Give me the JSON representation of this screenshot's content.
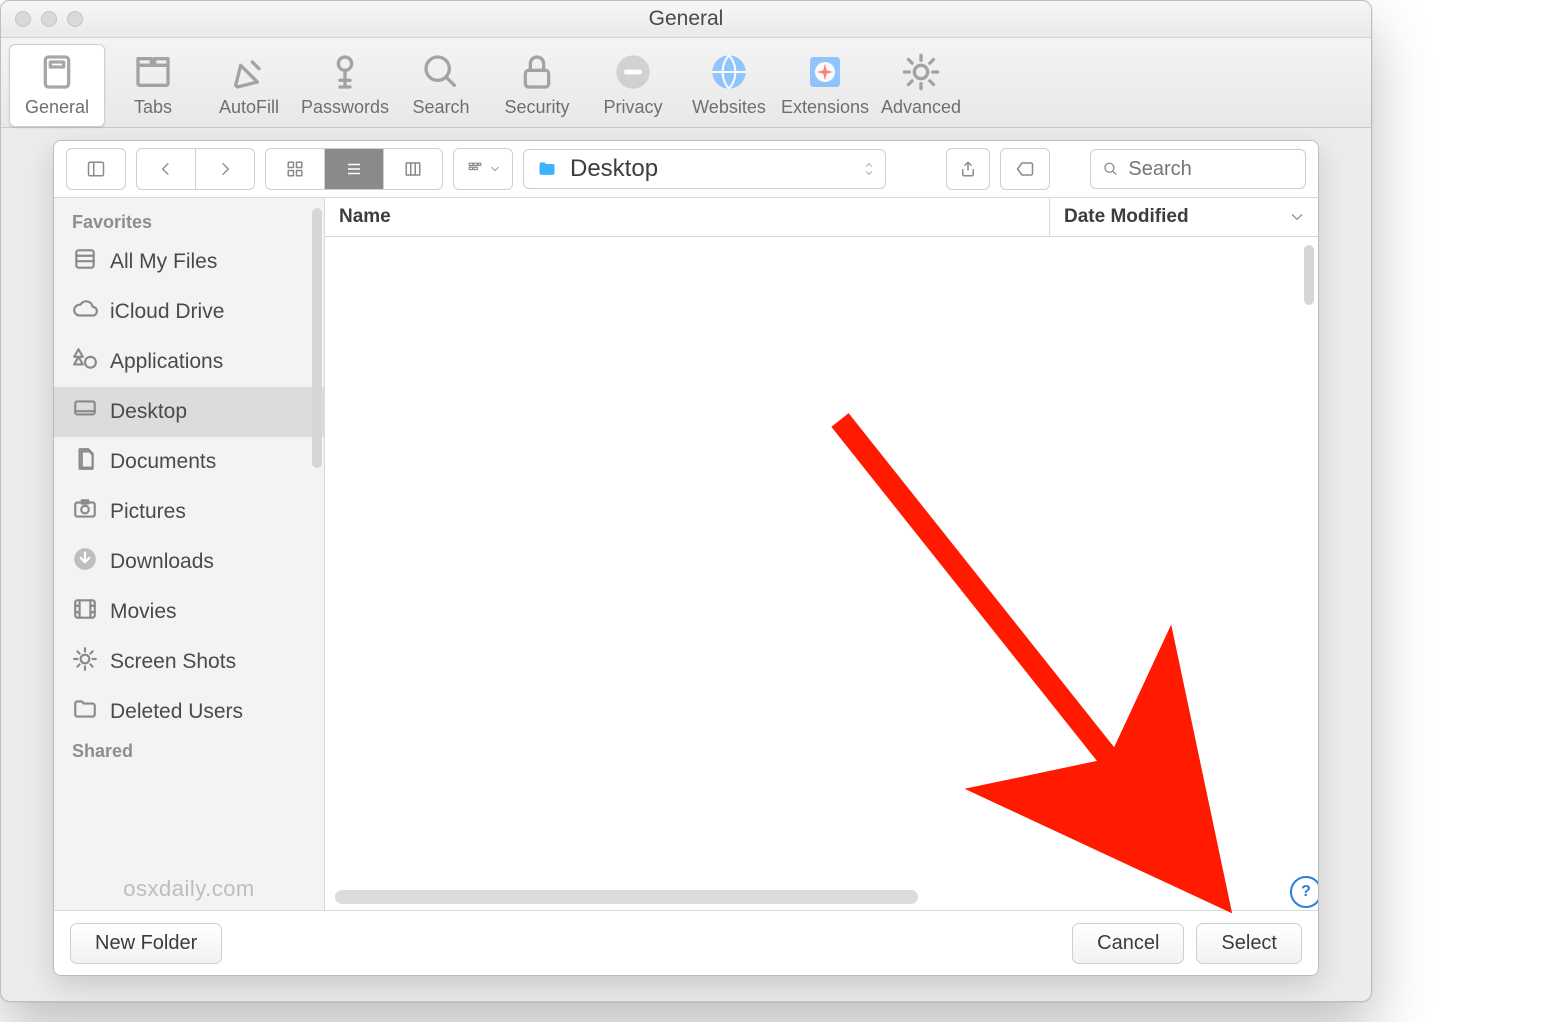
{
  "window": {
    "title": "General"
  },
  "prefs": {
    "items": [
      {
        "id": "general",
        "label": "General",
        "selected": true,
        "icon": "general-icon"
      },
      {
        "id": "tabs",
        "label": "Tabs",
        "icon": "tabs-icon"
      },
      {
        "id": "autofill",
        "label": "AutoFill",
        "icon": "autofill-icon"
      },
      {
        "id": "passwords",
        "label": "Passwords",
        "icon": "passwords-icon"
      },
      {
        "id": "search",
        "label": "Search",
        "icon": "search-icon"
      },
      {
        "id": "security",
        "label": "Security",
        "icon": "security-icon"
      },
      {
        "id": "privacy",
        "label": "Privacy",
        "icon": "privacy-icon"
      },
      {
        "id": "websites",
        "label": "Websites",
        "icon": "websites-icon"
      },
      {
        "id": "extensions",
        "label": "Extensions",
        "icon": "extensions-icon"
      },
      {
        "id": "advanced",
        "label": "Advanced",
        "icon": "advanced-icon"
      }
    ]
  },
  "finder_toolbar": {
    "location_label": "Desktop",
    "search_placeholder": "Search"
  },
  "sidebar": {
    "groups": [
      {
        "title": "Favorites",
        "items": [
          {
            "id": "all-my-files",
            "label": "All My Files",
            "icon": "all-my-files-icon"
          },
          {
            "id": "icloud",
            "label": "iCloud Drive",
            "icon": "icloud-icon"
          },
          {
            "id": "applications",
            "label": "Applications",
            "icon": "applications-icon"
          },
          {
            "id": "desktop",
            "label": "Desktop",
            "icon": "desktop-icon",
            "selected": true
          },
          {
            "id": "documents",
            "label": "Documents",
            "icon": "documents-icon"
          },
          {
            "id": "pictures",
            "label": "Pictures",
            "icon": "pictures-icon"
          },
          {
            "id": "downloads",
            "label": "Downloads",
            "icon": "downloads-icon"
          },
          {
            "id": "movies",
            "label": "Movies",
            "icon": "movies-icon"
          },
          {
            "id": "screenshots",
            "label": "Screen Shots",
            "icon": "screenshots-icon"
          },
          {
            "id": "deleted-users",
            "label": "Deleted Users",
            "icon": "folder-icon"
          }
        ]
      },
      {
        "title": "Shared",
        "items": []
      }
    ],
    "watermark": "osxdaily.com"
  },
  "columns": {
    "name": "Name",
    "date_modified": "Date Modified"
  },
  "footer": {
    "new_folder": "New Folder",
    "cancel": "Cancel",
    "select": "Select"
  },
  "annotation": {
    "arrow_color": "#ff1a00"
  }
}
